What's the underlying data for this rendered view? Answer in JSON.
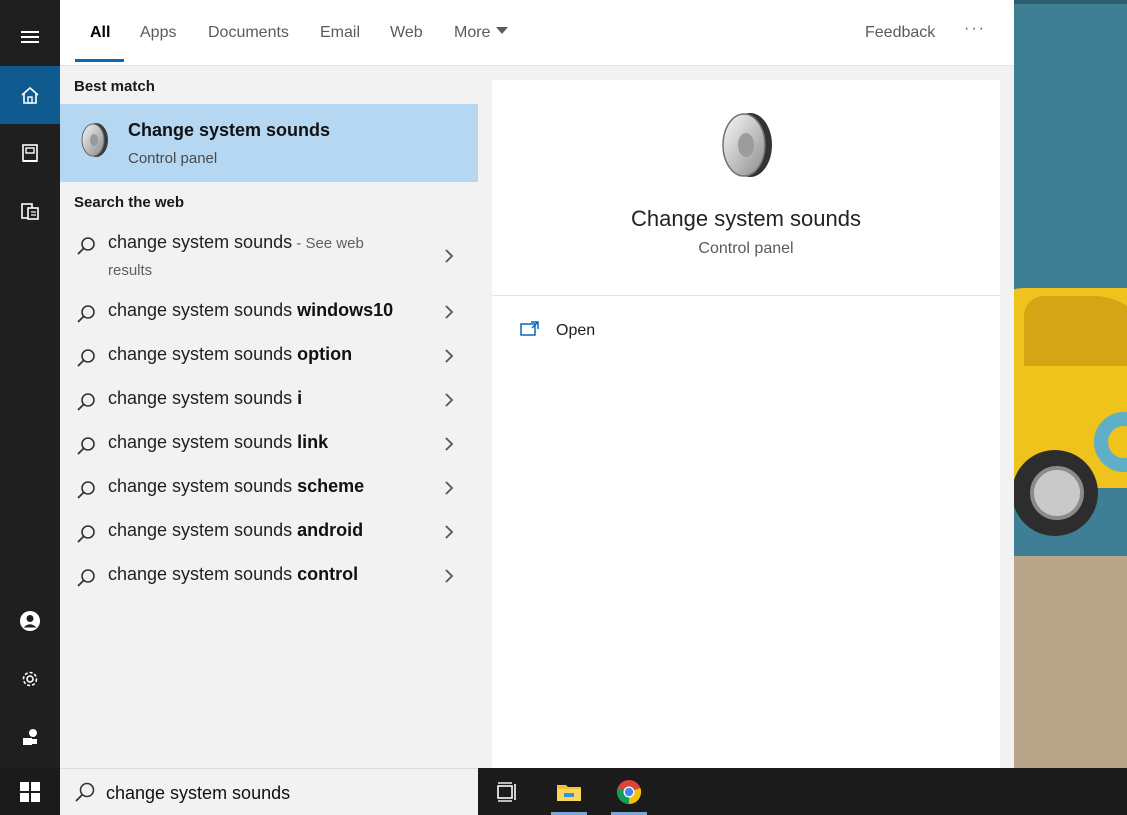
{
  "tabs": [
    {
      "label": "All"
    },
    {
      "label": "Apps"
    },
    {
      "label": "Documents"
    },
    {
      "label": "Email"
    },
    {
      "label": "Web"
    },
    {
      "label": "More"
    }
  ],
  "feedback_label": "Feedback",
  "more_options_label": "···",
  "best_match": {
    "heading": "Best match",
    "title": "Change system sounds",
    "subtitle": "Control panel",
    "icon": "speaker-icon"
  },
  "search_web": {
    "heading": "Search the web",
    "first": {
      "prefix": "change system sounds",
      "suffix": " - See web",
      "suffix2": "results"
    },
    "items": [
      {
        "prefix": "change system sounds ",
        "bold": "windows10"
      },
      {
        "prefix": "change system sounds ",
        "bold": "option"
      },
      {
        "prefix": "change system sounds ",
        "bold": "i"
      },
      {
        "prefix": "change system sounds ",
        "bold": "link"
      },
      {
        "prefix": "change system sounds ",
        "bold": "scheme"
      },
      {
        "prefix": "change system sounds ",
        "bold": "android"
      },
      {
        "prefix": "change system sounds ",
        "bold": "control"
      }
    ]
  },
  "preview": {
    "title": "Change system sounds",
    "subtitle": "Control panel",
    "open_label": "Open"
  },
  "search_box": {
    "value": "change system sounds"
  },
  "rail_icons": [
    "hamburger-icon",
    "home-icon",
    "notebook-icon",
    "documents-icon",
    "user-icon",
    "gear-icon",
    "feedback-icon"
  ],
  "taskbar_icons": [
    "windows-icon",
    "task-view-icon",
    "file-explorer-icon",
    "chrome-icon"
  ],
  "colors": {
    "accent": "#0a68b7",
    "best_match_bg": "#b6d7f2",
    "rail_active": "#0f5a8f"
  }
}
